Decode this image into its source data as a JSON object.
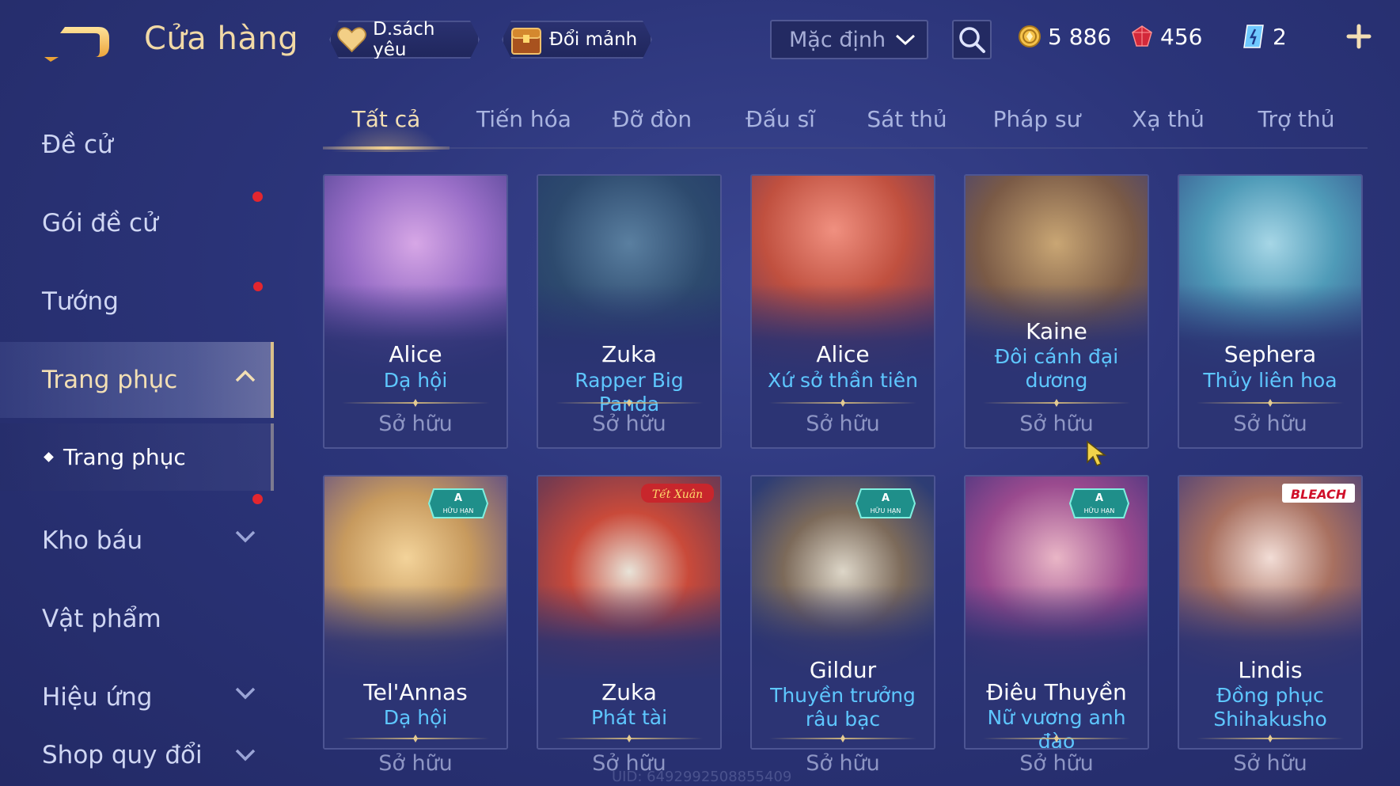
{
  "header": {
    "title": "Cửa hàng",
    "wishlist_label": "D.sách yêu",
    "exchange_label": "Đổi mảnh",
    "sort_value": "Mặc định"
  },
  "currencies": {
    "gold": "5 886",
    "ruby": "456",
    "voucher": "2"
  },
  "sidebar": {
    "items": [
      {
        "label": "Đề cử"
      },
      {
        "label": "Gói đề cử"
      },
      {
        "label": "Tướng"
      },
      {
        "label": "Trang phục"
      },
      {
        "label": "Kho báu"
      },
      {
        "label": "Vật phẩm"
      },
      {
        "label": "Hiệu ứng"
      },
      {
        "label": "Shop quy đổi"
      }
    ],
    "sub_item": "Trang phục"
  },
  "tabs": [
    "Tất cả",
    "Tiến hóa",
    "Đỡ đòn",
    "Đấu sĩ",
    "Sát thủ",
    "Pháp sư",
    "Xạ thủ",
    "Trợ thủ"
  ],
  "cards": [
    {
      "hero": "Alice",
      "skin": "Dạ hội",
      "status": "Sở hữu"
    },
    {
      "hero": "Zuka",
      "skin": "Rapper Big Panda",
      "status": "Sở hữu"
    },
    {
      "hero": "Alice",
      "skin": "Xứ sở thần tiên",
      "status": "Sở hữu"
    },
    {
      "hero": "Kaine",
      "skin": "Đôi cánh đại dương",
      "status": "Sở hữu"
    },
    {
      "hero": "Sephera",
      "skin": "Thủy liên hoa",
      "status": "Sở hữu"
    },
    {
      "hero": "Tel'Annas",
      "skin": "Dạ hội",
      "status": "Sở hữu",
      "badge": "A",
      "badge_sub": "HỮU HẠN"
    },
    {
      "hero": "Zuka",
      "skin": "Phát tài",
      "status": "Sở hữu",
      "event": "Tết Xuân"
    },
    {
      "hero": "Gildur",
      "skin": "Thuyền trưởng râu bạc",
      "status": "Sở hữu",
      "badge": "A",
      "badge_sub": "HỮU HẠN"
    },
    {
      "hero": "Điêu Thuyền",
      "skin": "Nữ vương anh đào",
      "status": "Sở hữu",
      "badge": "A",
      "badge_sub": "HỮU HẠN"
    },
    {
      "hero": "Lindis",
      "skin": "Đồng phục Shihakusho",
      "status": "Sở hữu",
      "event": "BLEACH"
    }
  ],
  "uid": "UID: 6492992508855409",
  "colors": {
    "accent_gold": "#f3dfb4",
    "skin_name_blue": "#5ec7ff",
    "notification_red": "#e3262f"
  }
}
